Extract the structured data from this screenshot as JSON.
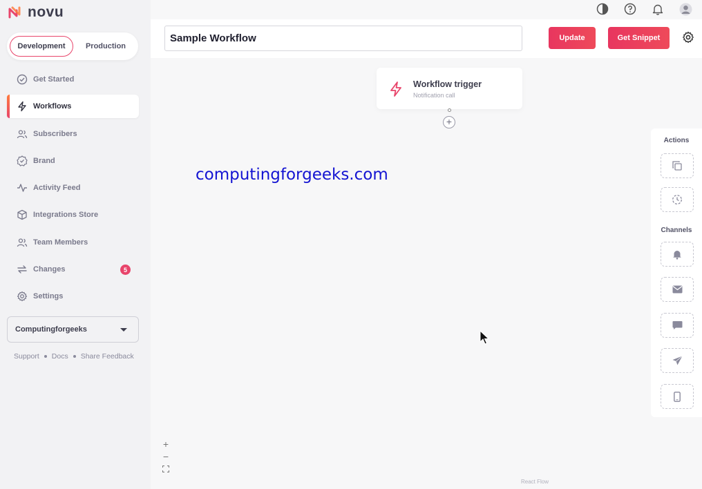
{
  "app": {
    "name": "novu"
  },
  "environment": {
    "options": [
      "Development",
      "Production"
    ],
    "selected": "Development"
  },
  "sidebar": {
    "items": [
      {
        "label": "Get Started",
        "icon": "check-circle-icon"
      },
      {
        "label": "Workflows",
        "icon": "bolt-icon",
        "active": true
      },
      {
        "label": "Subscribers",
        "icon": "users-icon"
      },
      {
        "label": "Brand",
        "icon": "badge-check-icon"
      },
      {
        "label": "Activity Feed",
        "icon": "activity-icon"
      },
      {
        "label": "Integrations Store",
        "icon": "box-icon"
      },
      {
        "label": "Team Members",
        "icon": "team-icon"
      },
      {
        "label": "Changes",
        "icon": "swap-icon",
        "badge": "5"
      },
      {
        "label": "Settings",
        "icon": "gear-icon"
      }
    ],
    "organization": "Computingforgeeks",
    "footer": {
      "support": "Support",
      "docs": "Docs",
      "feedback": "Share Feedback"
    }
  },
  "header": {
    "workflow_name": "Sample Workflow",
    "update_label": "Update",
    "snippet_label": "Get Snippet",
    "icons": [
      "theme-toggle-icon",
      "help-icon",
      "bell-icon",
      "avatar-icon"
    ]
  },
  "canvas": {
    "trigger": {
      "title": "Workflow trigger",
      "subtitle": "Notification call"
    },
    "watermark": "computingforgeeks.com",
    "attribution": "React Flow",
    "zoom_controls": [
      "+",
      "−"
    ]
  },
  "right_panel": {
    "actions_label": "Actions",
    "channels_label": "Channels",
    "actions": [
      "digest-icon",
      "delay-icon"
    ],
    "channels": [
      "in-app-bell-icon",
      "email-icon",
      "sms-chat-icon",
      "chat-send-icon",
      "push-mobile-icon"
    ]
  },
  "colors": {
    "accent": "#e8456b",
    "accent_gradient_start": "#e8365f",
    "watermark": "#1414d2"
  }
}
